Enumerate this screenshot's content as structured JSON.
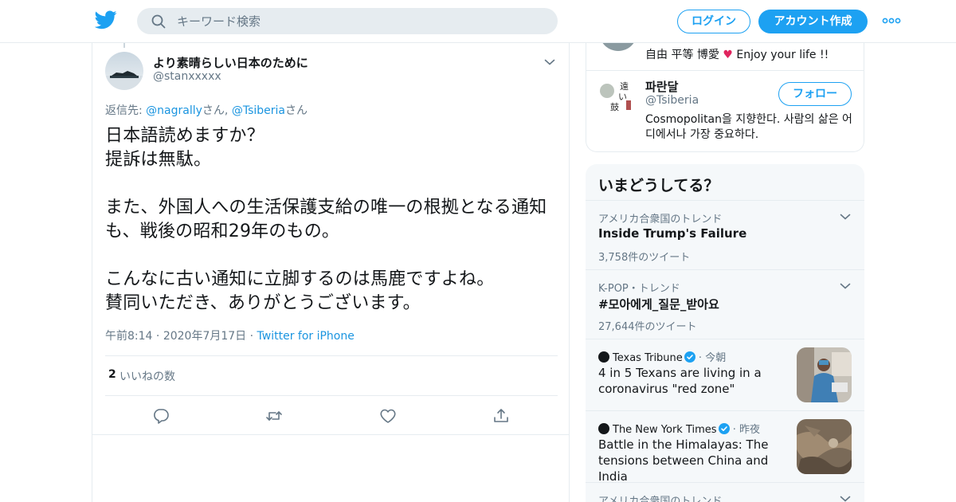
{
  "header": {
    "search_placeholder": "キーワード検索",
    "login_label": "ログイン",
    "signup_label": "アカウント作成"
  },
  "tweet": {
    "author_name": "より素晴らしい日本のために",
    "author_handle": "@stanxxxxx",
    "reply_prefix": "返信先: ",
    "reply_user1": "@nagrally",
    "reply_san1": "さん",
    "reply_sep": ", ",
    "reply_user2": "@Tsiberia",
    "reply_san2": "さん",
    "text": "日本語読めますか？\n提訴は無駄。\n\nまた、外国人への生活保護支給の唯一の根拠となる通知も、戦後の昭和29年のもの。\n\nこんなに古い通知に立脚するのは馬鹿ですよね。\n賛同いただき、ありがとうございます。",
    "time": "午前8:14",
    "date": "2020年7月17日",
    "source": "Twitter for iPhone",
    "like_count": "2",
    "like_label": "いいねの数"
  },
  "who_to_follow": {
    "prev_bio_prefix": "自由 平等 博愛 ",
    "prev_bio_heart": "♥",
    "prev_bio_suffix": " Enjoy your life !!",
    "user_name": "파란달",
    "user_handle": "@Tsiberia",
    "follow_label": "フォロー",
    "user_bio": "Cosmopolitan을 지향한다. 사람의 삶은 어디에서나 가장 중요하다."
  },
  "trends": {
    "title": "いまどうしてる？",
    "items": [
      {
        "context": "アメリカ合衆国のトレンド",
        "title": "Inside Trump's Failure",
        "count": "3,758件のツイート"
      },
      {
        "context": "K-POP・トレンド",
        "title": "#모아에게_질문_받아요",
        "count": "27,644件のツイート"
      },
      {
        "context": "アメリカ合衆国のトレンド"
      }
    ],
    "news": [
      {
        "source": "Texas Tribune",
        "time": "今朝",
        "headline": "4 in 5 Texans are living in a coronavirus \"red zone\""
      },
      {
        "source": "The New York Times",
        "time": "昨夜",
        "headline": "Battle in the Himalayas: The tensions between China and India"
      }
    ]
  },
  "colors": {
    "accent": "#1da1f2",
    "link": "#1b95e0",
    "secondary_text": "#657786",
    "border": "#e6ecf0",
    "like_heart": "#e0245e"
  }
}
